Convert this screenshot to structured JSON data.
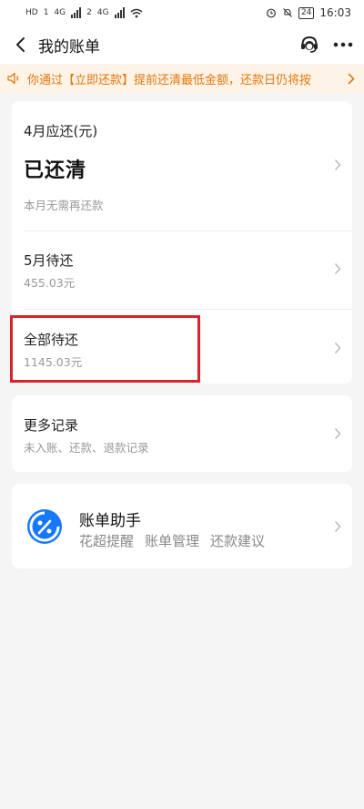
{
  "status_bar": {
    "left": "HD",
    "sim1": "1",
    "sim2": "2",
    "net1": "4G",
    "net2": "4G",
    "battery": "24",
    "time": "16:03"
  },
  "header": {
    "title": "我的账单"
  },
  "notice": {
    "text": "你通过【立即还款】提前还清最低金额，还款日仍将按"
  },
  "bill": {
    "current_month_label": "4月应还(元)",
    "current_status": "已还清",
    "current_note": "本月无需再还款",
    "next_label": "5月待还",
    "next_amount": "455.03元",
    "total_label": "全部待还",
    "total_amount": "1145.03元"
  },
  "records": {
    "title": "更多记录",
    "subtitle": "未入账、还款、退款记录"
  },
  "assistant": {
    "title": "账单助手",
    "links": [
      "花超提醒",
      "账单管理",
      "还款建议"
    ]
  },
  "colors": {
    "notice_text": "#e5770e",
    "notice_bg": "#fdf3e6",
    "highlight": "#d8232a",
    "assist_blue": "#1677ff"
  }
}
